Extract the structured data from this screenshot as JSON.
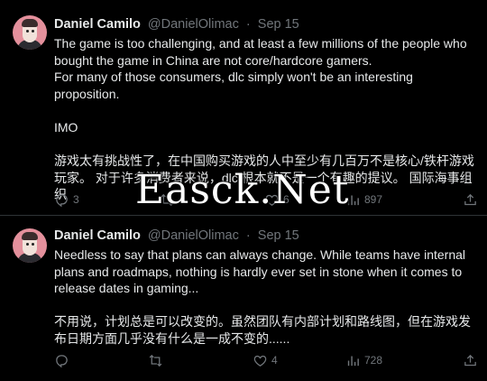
{
  "tweets": [
    {
      "author": {
        "display_name": "Daniel Camilo",
        "handle": "@DanielOlimac",
        "date": "Sep 15"
      },
      "paragraphs": [
        "The game is too challenging, and at least a few millions of the people who bought the game in China are not core/hardcore gamers.",
        "For many of those consumers, dlc simply won't be an interesting proposition.",
        "IMO",
        "游戏太有挑战性了，在中国购买游戏的人中至少有几百万不是核心/铁杆游戏玩家。 对于许多消费者来说，dlc 根本就不是一个有趣的提议。 国际海事组织"
      ],
      "actions": {
        "reply_count": "3",
        "repost_count": "",
        "like_count": "6",
        "view_count": "897"
      }
    },
    {
      "author": {
        "display_name": "Daniel Camilo",
        "handle": "@DanielOlimac",
        "date": "Sep 15"
      },
      "paragraphs": [
        "Needless to say that plans can always change. While teams have internal plans and roadmaps, nothing is hardly ever set in stone when it comes to release dates in gaming...",
        "不用说，计划总是可以改变的。虽然团队有内部计划和路线图，但在游戏发布日期方面几乎没有什么是一成不变的......"
      ],
      "actions": {
        "reply_count": "",
        "repost_count": "",
        "like_count": "4",
        "view_count": "728"
      }
    }
  ],
  "watermark": "Easck.Net",
  "icons": [
    "reply-icon",
    "repost-icon",
    "like-icon",
    "views-icon",
    "share-icon"
  ],
  "colors": {
    "background": "#000000",
    "text": "#e7e9ea",
    "muted": "#71767b",
    "divider": "#2f3336"
  }
}
